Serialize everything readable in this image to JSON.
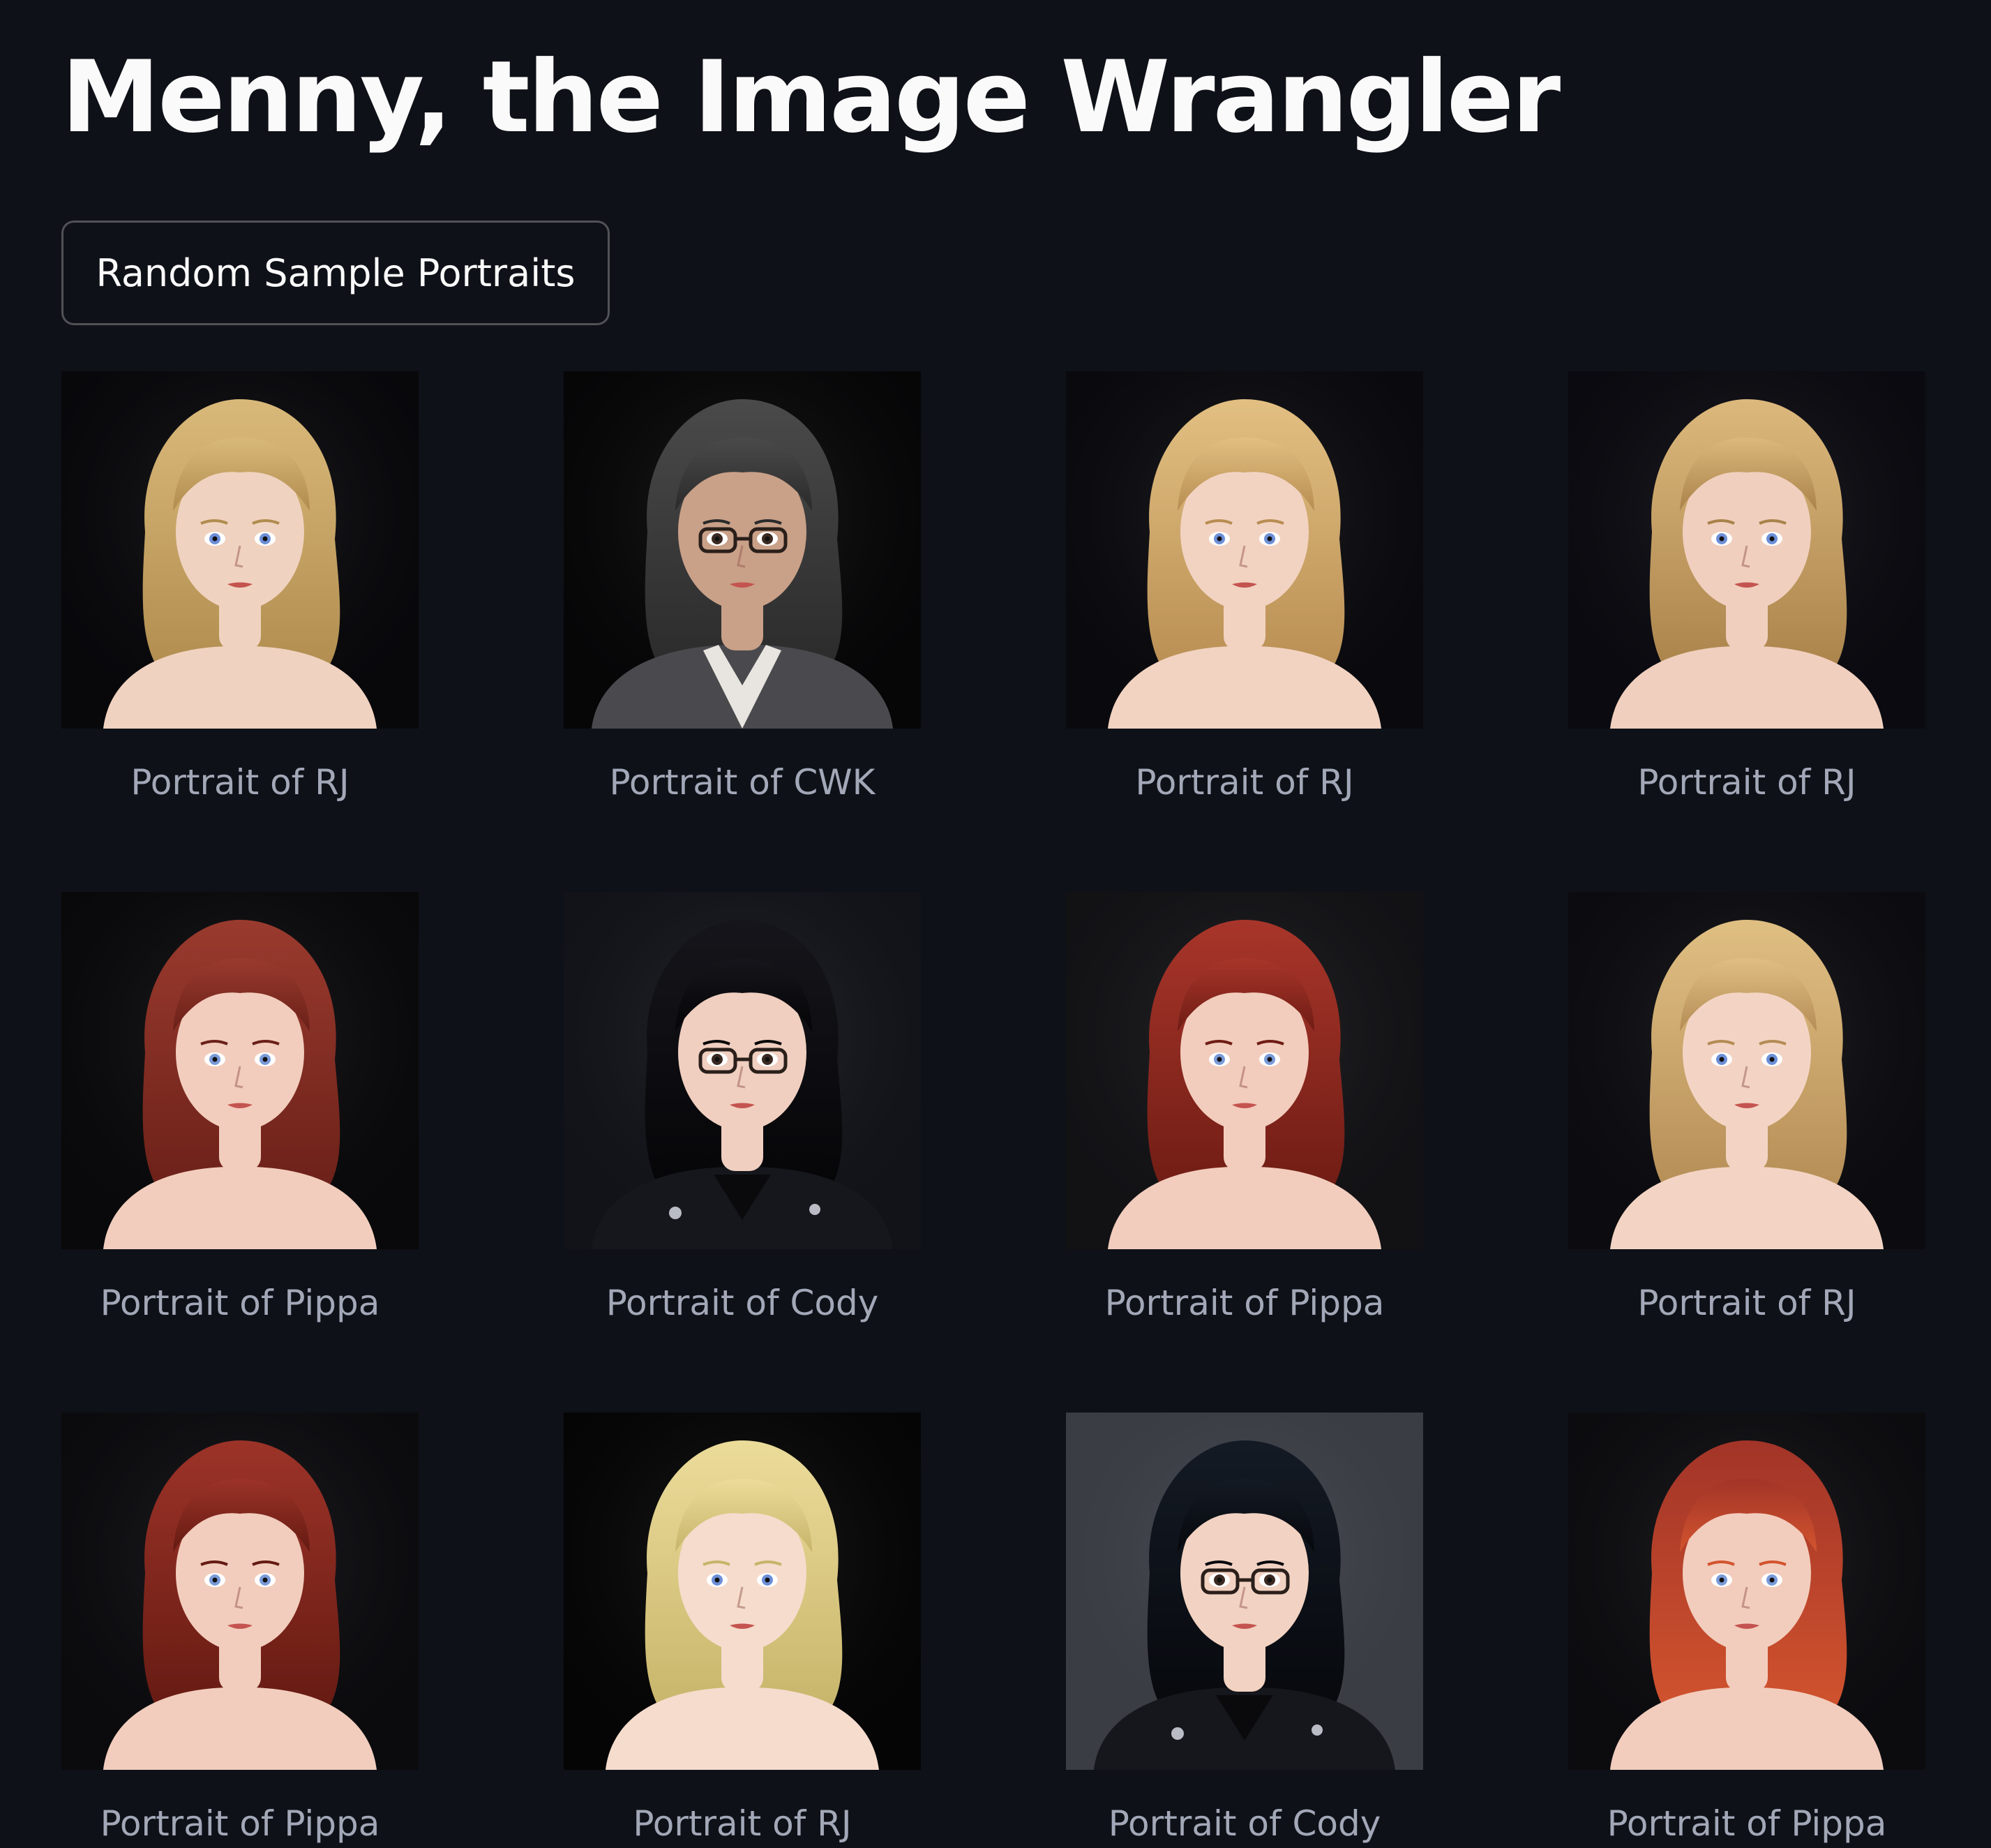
{
  "app": {
    "title": "Menny, the Image Wrangler"
  },
  "controls": {
    "random_sample_label": "Random Sample Portraits"
  },
  "gallery": {
    "items": [
      {
        "caption": "Portrait of RJ",
        "hair": "#d9b97a",
        "hair_dark": "#b08c4e",
        "bg": "#08080b",
        "skin": "#f0d2c0",
        "glasses": false,
        "jacket": "none",
        "eye": "#6d8fd8"
      },
      {
        "caption": "Portrait of CWK",
        "hair": "#4a4a4a",
        "hair_dark": "#2a2a2a",
        "bg": "#060607",
        "skin": "#c9a088",
        "glasses": true,
        "jacket": "gray",
        "eye": "#3b2a22"
      },
      {
        "caption": "Portrait of RJ",
        "hair": "#e2bf82",
        "hair_dark": "#b88d52",
        "bg": "#0a0a0e",
        "skin": "#f2d3c2",
        "glasses": false,
        "jacket": "none",
        "eye": "#6d8fd8"
      },
      {
        "caption": "Portrait of RJ",
        "hair": "#dcb87c",
        "hair_dark": "#a9824a",
        "bg": "#0a0a10",
        "skin": "#f0cfbe",
        "glasses": false,
        "jacket": "none",
        "eye": "#6d8fd8"
      },
      {
        "caption": "Portrait of Pippa",
        "hair": "#9a3a2e",
        "hair_dark": "#6a2018",
        "bg": "#09090b",
        "skin": "#f2cdbd",
        "glasses": false,
        "jacket": "none",
        "eye": "#7a9ad8"
      },
      {
        "caption": "Portrait of Cody",
        "hair": "#15151b",
        "hair_dark": "#050507",
        "bg": "#111319",
        "skin": "#f0cfc0",
        "glasses": true,
        "jacket": "black",
        "eye": "#3b2a22"
      },
      {
        "caption": "Portrait of Pippa",
        "hair": "#a8352a",
        "hair_dark": "#6e1c14",
        "bg": "#121215",
        "skin": "#f2cdbd",
        "glasses": false,
        "jacket": "none",
        "eye": "#7a9ad8"
      },
      {
        "caption": "Portrait of RJ",
        "hair": "#e0bf83",
        "hair_dark": "#b48c55",
        "bg": "#0c0c10",
        "skin": "#f3d4c4",
        "glasses": false,
        "jacket": "none",
        "eye": "#6d8fd8"
      },
      {
        "caption": "Portrait of Pippa",
        "hair": "#9c3328",
        "hair_dark": "#641a12",
        "bg": "#0b0b0e",
        "skin": "#f2cdbd",
        "glasses": false,
        "jacket": "none",
        "eye": "#7a9ad8"
      },
      {
        "caption": "Portrait of RJ",
        "hair": "#ecdc9a",
        "hair_dark": "#c7b46a",
        "bg": "#050505",
        "skin": "#f5dccd",
        "glasses": false,
        "jacket": "none",
        "eye": "#6d8fd8"
      },
      {
        "caption": "Portrait of Cody",
        "hair": "#141a24",
        "hair_dark": "#06080c",
        "bg": "#3a3d44",
        "skin": "#f2d2c2",
        "glasses": true,
        "jacket": "black",
        "eye": "#3b2a22"
      },
      {
        "caption": "Portrait of Pippa",
        "hair": "#a23428",
        "hair_dark": "#d2542e",
        "bg": "#0c0c0f",
        "skin": "#f2cdbd",
        "glasses": false,
        "jacket": "none",
        "eye": "#7a9ad8"
      }
    ]
  }
}
